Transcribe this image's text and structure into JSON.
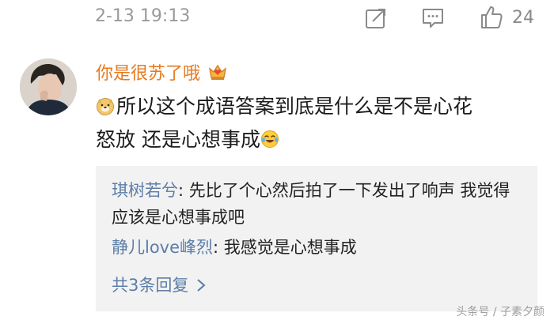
{
  "post": {
    "timestamp": "2-13 19:13",
    "like_count": "24"
  },
  "comment": {
    "username": "你是很苏了哦",
    "text_line1": "所以这个成语答案到底是什么是不是心花",
    "text_line2": "怒放 还是心想事成"
  },
  "replies": [
    {
      "user": "琪树若兮",
      "text": ": 先比了个心然后拍了一下发出了响声 我觉得应该是心想事成吧"
    },
    {
      "user": "静儿love峰烈",
      "text": ": 我感觉是心想事成"
    }
  ],
  "more_replies": "共3条回复",
  "watermark": "头条号 / 子素夕颜",
  "icons": {
    "share": "share-icon",
    "comment": "comment-icon",
    "like": "thumbs-up-icon",
    "vip": "vip-crown-icon",
    "emoji1": "doge-emoji-icon",
    "emoji2": "laugh-cry-emoji-icon",
    "chevron": "chevron-right-icon"
  },
  "colors": {
    "username": "#e8791d",
    "reply_user": "#5c7da8",
    "meta": "#9a9a9a",
    "reply_bg": "#f2f2f2"
  }
}
